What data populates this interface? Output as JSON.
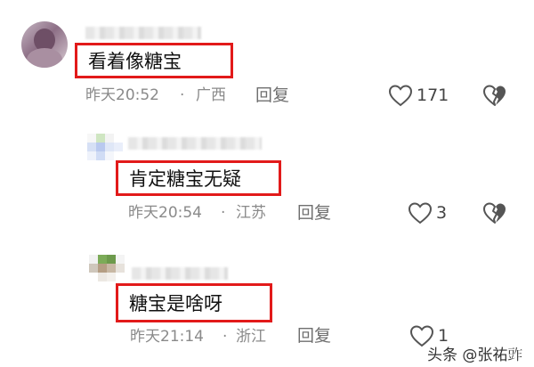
{
  "comments": [
    {
      "text": "看着像糖宝",
      "time": "昨天20:52",
      "region": "广西",
      "reply_label": "回复",
      "likes": "171"
    },
    {
      "text": "肯定糖宝无疑",
      "time": "昨天20:54",
      "region": "江苏",
      "reply_label": "回复",
      "likes": "3"
    },
    {
      "text": "糖宝是啥呀",
      "time": "昨天21:14",
      "region": "浙江",
      "reply_label": "回复",
      "likes": "1"
    }
  ],
  "separator": "·",
  "watermark": "头条 @张祐𧯤",
  "colors": {
    "highlight_border": "#e21a1a",
    "meta": "#8a8a8a"
  },
  "icons": [
    "heart-outline-icon",
    "broken-heart-icon"
  ]
}
